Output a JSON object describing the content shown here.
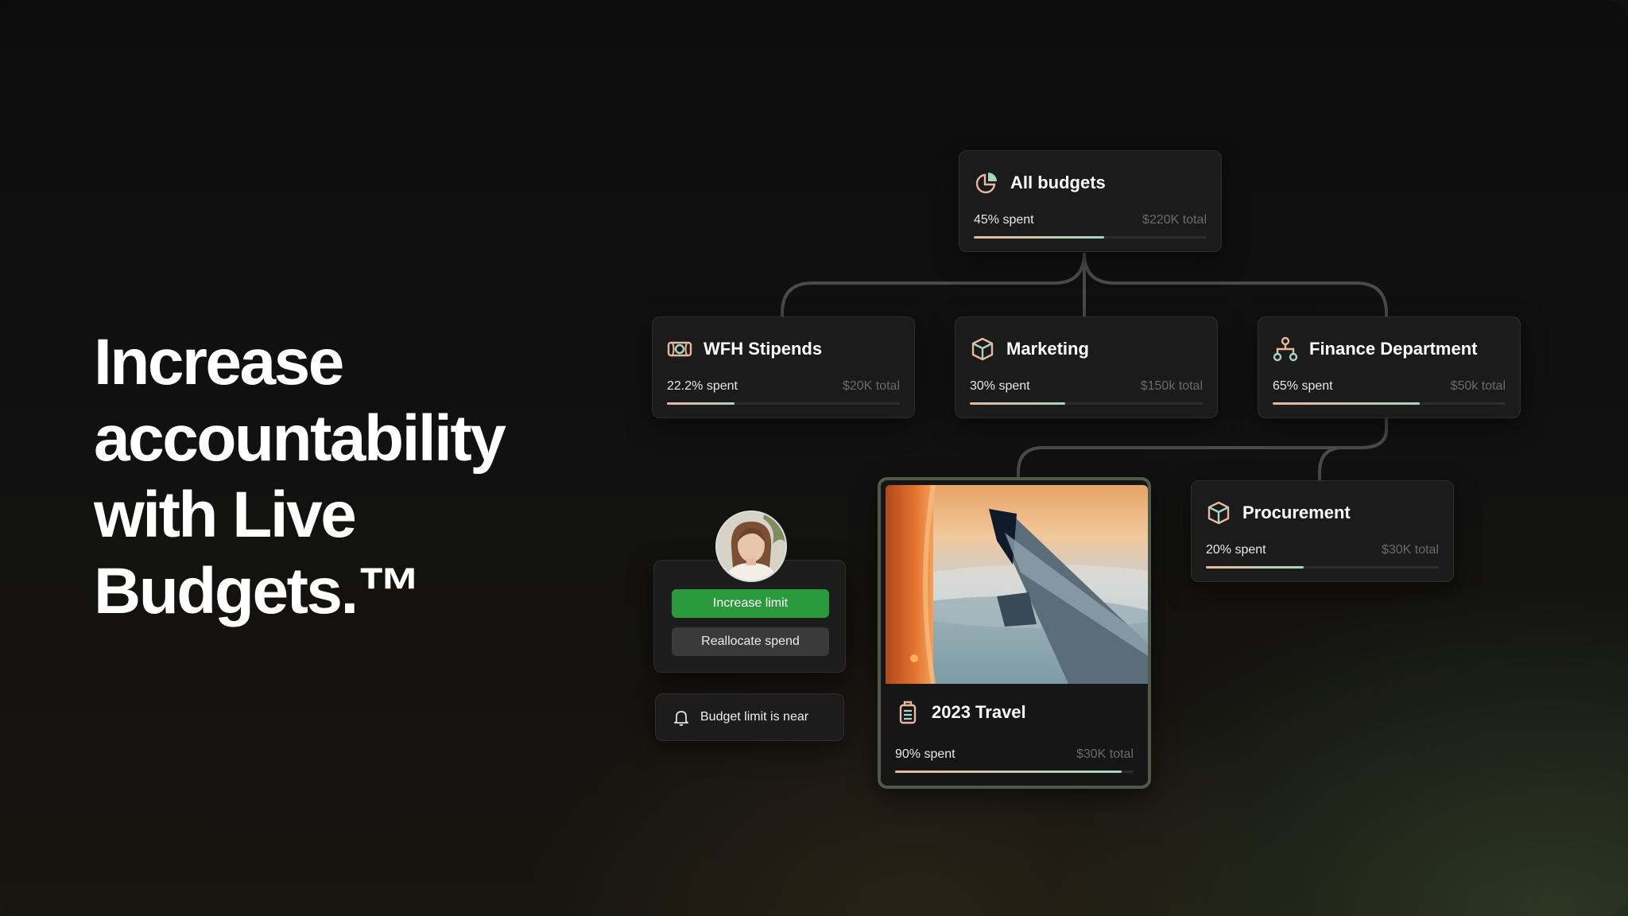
{
  "headline": [
    "Increase",
    "accountability",
    "with Live",
    "Budgets.™"
  ],
  "budgets": {
    "all": {
      "title": "All budgets",
      "spent": "45% spent",
      "total": "$220K total",
      "pct": 0.56,
      "icon": "pie-chart-icon"
    },
    "wfh": {
      "title": "WFH Stipends",
      "spent": "22.2% spent",
      "total": "$20K total",
      "pct": 0.29,
      "icon": "money-bill-icon"
    },
    "marketing": {
      "title": "Marketing",
      "spent": "30% spent",
      "total": "$150k total",
      "pct": 0.41,
      "icon": "box-icon"
    },
    "finance": {
      "title": "Finance Department",
      "spent": "65% spent",
      "total": "$50k total",
      "pct": 0.63,
      "icon": "org-chart-icon"
    },
    "procurement": {
      "title": "Procurement",
      "spent": "20% spent",
      "total": "$30K total",
      "pct": 0.42,
      "icon": "box-icon"
    },
    "travel": {
      "title": "2023 Travel",
      "spent": "90% spent",
      "total": "$30K total",
      "pct": 0.95,
      "icon": "luggage-icon"
    }
  },
  "actions": {
    "increase_label": "Increase limit",
    "reallocate_label": "Reallocate spend"
  },
  "alert": {
    "text": "Budget limit is near",
    "icon": "bell-icon"
  },
  "colors": {
    "accent_green": "#2b9a3c",
    "progress_start": "#e9b79c",
    "progress_end": "#a6d6c3"
  }
}
